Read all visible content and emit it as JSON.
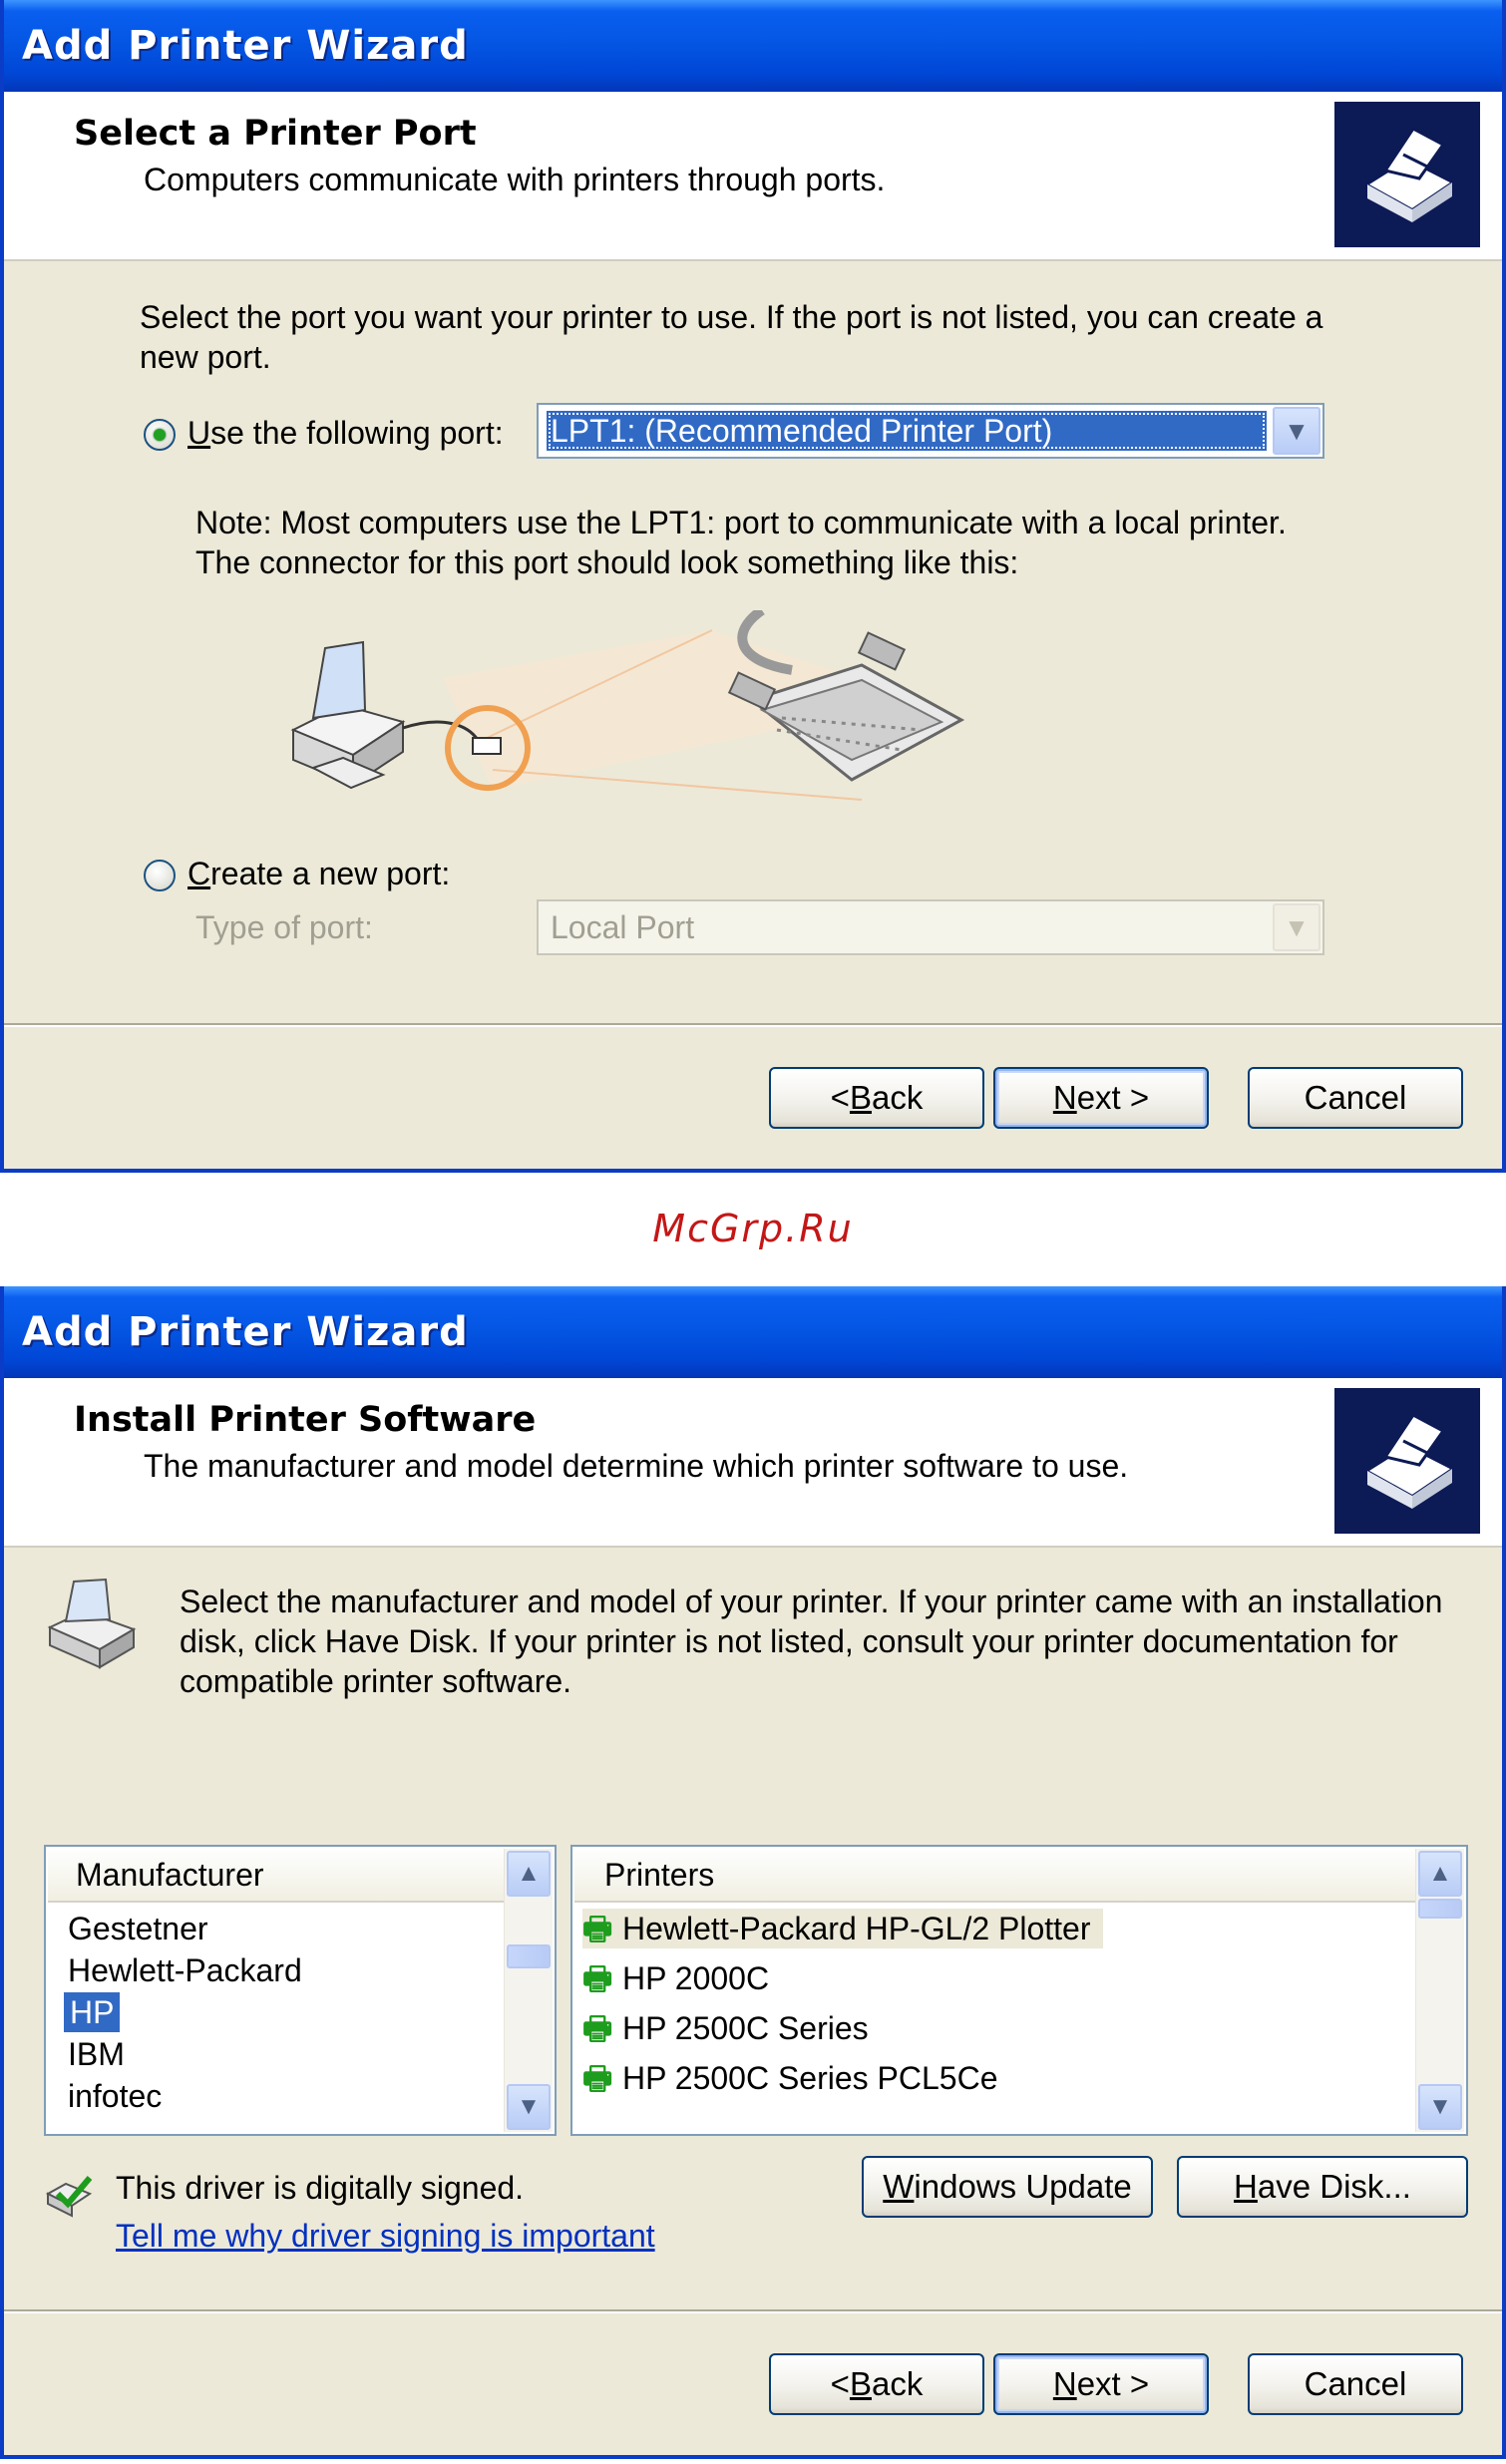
{
  "watermark": "McGrp.Ru",
  "window1": {
    "title": "Add Printer Wizard",
    "header_title": "Select a Printer Port",
    "header_subtitle": "Computers communicate with printers through ports.",
    "instruction_line1": "Select the port you want your printer to use.  If the port is not listed, you can create a",
    "instruction_line2": "new port.",
    "radio_use_pre": "",
    "radio_use_u": "U",
    "radio_use_post": "se the following port:",
    "port_value": "LPT1: (Recommended Printer Port)",
    "note_line1": "Note: Most computers use the LPT1: port to communicate with a local printer.",
    "note_line2": "The connector for this port should look something like this:",
    "radio_create_u": "C",
    "radio_create_post": "reate a new port:",
    "type_of_port_label": "Type of port:",
    "type_of_port_value": "Local Port",
    "back_pre": "< ",
    "back_u": "B",
    "back_post": "ack",
    "next_u": "N",
    "next_post": "ext >",
    "cancel": "Cancel"
  },
  "window2": {
    "title": "Add Printer Wizard",
    "header_title": "Install Printer Software",
    "header_subtitle": "The manufacturer and model determine which printer software to use.",
    "instruction_line1": "Select the manufacturer and model of your printer. If your printer came with an installation",
    "instruction_line2": "disk, click Have Disk. If your printer is not listed, consult your printer documentation for",
    "instruction_line3": "compatible printer software.",
    "manufacturer_header": "Manufacturer",
    "manufacturers": [
      "Gestetner",
      "Hewlett-Packard",
      "HP",
      "IBM",
      "infotec"
    ],
    "printers_header": "Printers",
    "printers": [
      "Hewlett-Packard HP-GL/2 Plotter",
      "HP 2000C",
      "HP 2500C Series",
      "HP 2500C Series PCL5Ce"
    ],
    "signed_text": "This driver is digitally signed.",
    "signing_link": "Tell me why driver signing is important",
    "windows_update_u": "W",
    "windows_update_post": "indows Update",
    "have_disk_u": "H",
    "have_disk_post": "ave Disk...",
    "back_pre": "< ",
    "back_u": "B",
    "back_post": "ack",
    "next_u": "N",
    "next_post": "ext >",
    "cancel": "Cancel"
  }
}
